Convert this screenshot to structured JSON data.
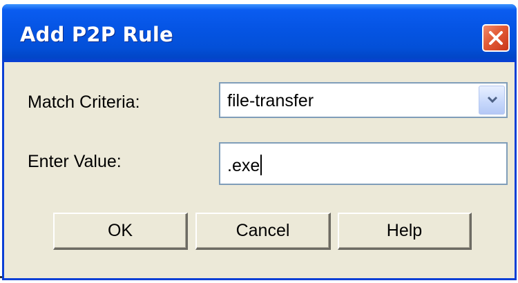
{
  "dialog": {
    "title": "Add P2P Rule",
    "close_icon": "close-x-icon"
  },
  "form": {
    "match_criteria_label": "Match Criteria:",
    "match_criteria_value": "file-transfer",
    "dropdown_icon": "chevron-down-icon",
    "enter_value_label": "Enter Value:",
    "enter_value_value": ".exe"
  },
  "buttons": {
    "ok": "OK",
    "cancel": "Cancel",
    "help": "Help"
  },
  "colors": {
    "titlebar": "#0554e3",
    "close_button": "#e25a35",
    "dialog_background": "#ece9d8",
    "field_border": "#7f9db9"
  }
}
